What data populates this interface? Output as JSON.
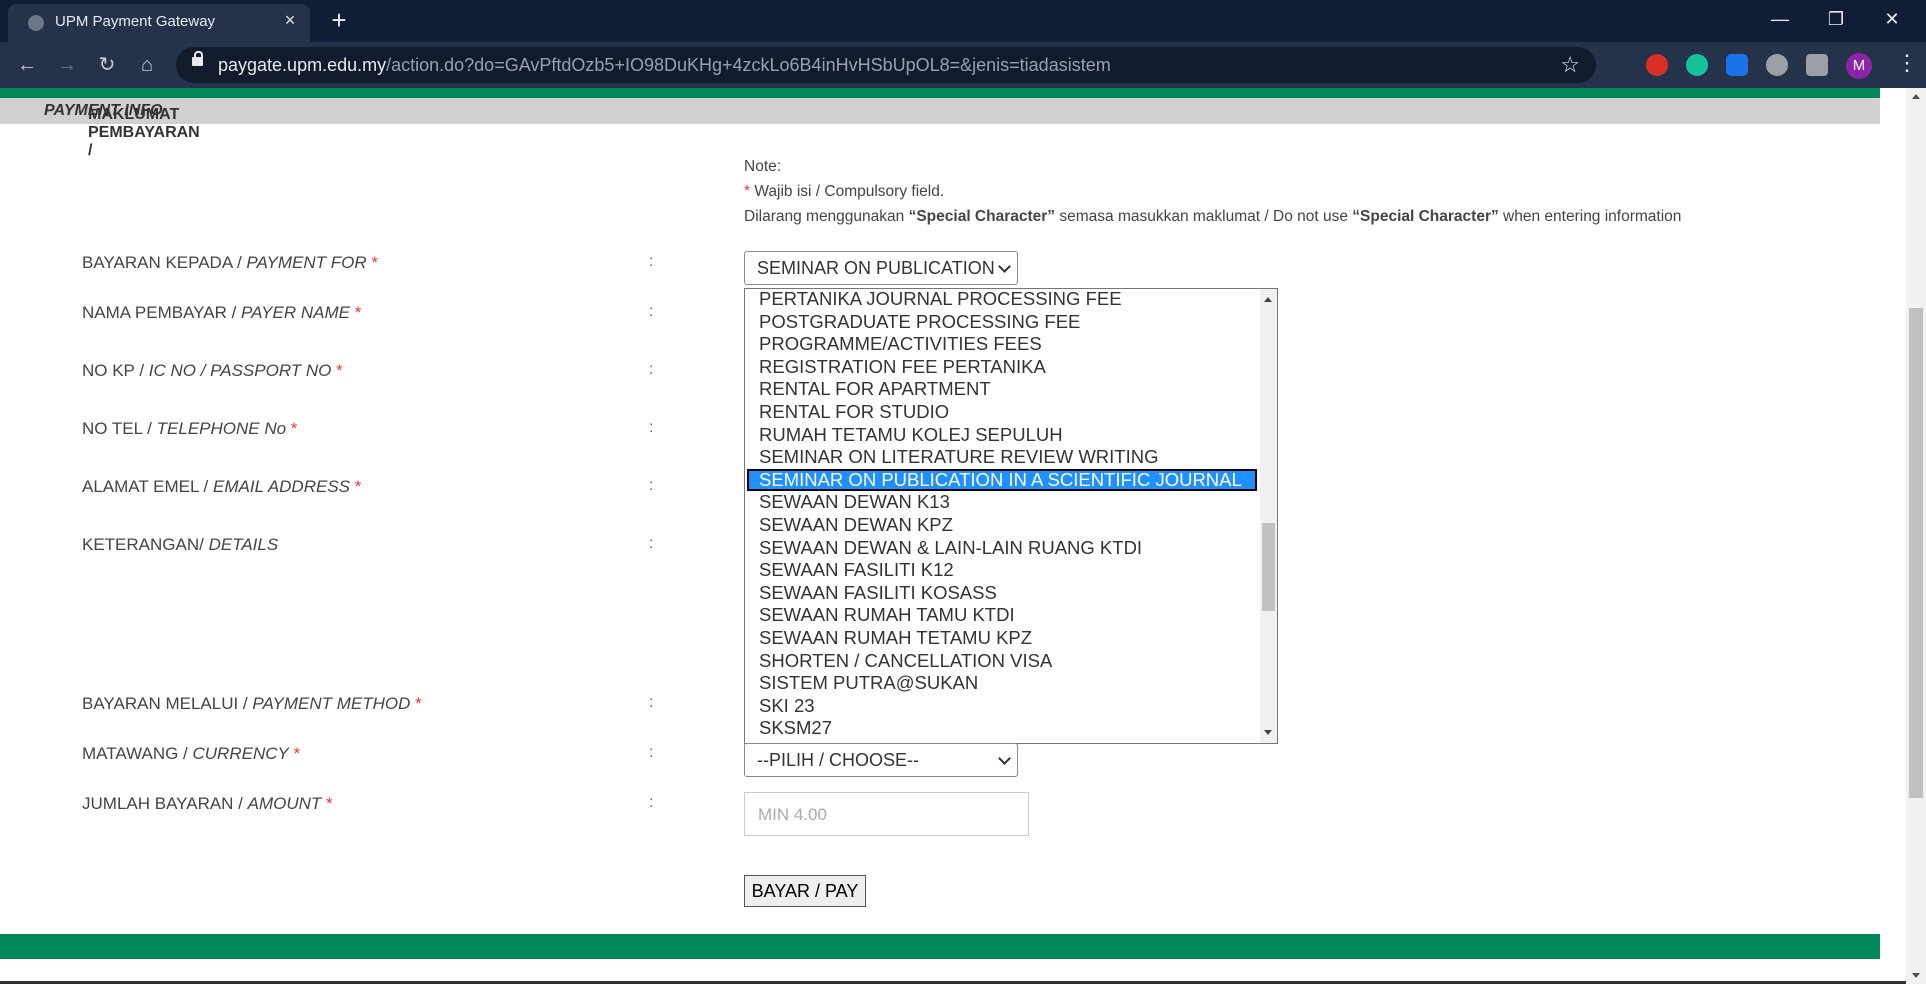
{
  "browser": {
    "tab_title": "UPM Payment Gateway",
    "url_host": "paygate.upm.edu.my",
    "url_rest": "/action.do?do=GAvPftdOzb5+IO98DuKHg+4zckLo6B4inHvHSbUpOL8=&jenis=tiadasistem",
    "profile_initial": "M"
  },
  "header": {
    "title_ms": "MAKLUMAT PEMBAYARAN / ",
    "title_en": "PAYMENT INFO"
  },
  "note": {
    "heading": "Note:",
    "required_mark": "*",
    "required_text": " Wajib isi / Compulsory field.",
    "sc_prefix": "Dilarang menggunakan ",
    "sc_term": "“Special Character”",
    "sc_middle": " semasa masukkan maklumat / Do not use ",
    "sc_term2": "“Special Character”",
    "sc_suffix": " when entering information"
  },
  "form": {
    "colon": ":",
    "required_mark": " *",
    "fields": [
      {
        "ms": "BAYARAN KEPADA / ",
        "en": "PAYMENT FOR"
      },
      {
        "ms": "NAMA PEMBAYAR / ",
        "en": "PAYER NAME"
      },
      {
        "ms": "NO KP / ",
        "en": "IC NO / PASSPORT NO"
      },
      {
        "ms": "NO TEL / ",
        "en": "TELEPHONE No"
      },
      {
        "ms": "ALAMAT EMEL / ",
        "en": "EMAIL ADDRESS"
      },
      {
        "ms": "KETERANGAN/ ",
        "en": "DETAILS"
      },
      {
        "ms": "BAYARAN MELALUI / ",
        "en": "PAYMENT METHOD"
      },
      {
        "ms": "MATAWANG / ",
        "en": "CURRENCY"
      },
      {
        "ms": "JUMLAH BAYARAN / ",
        "en": "AMOUNT"
      }
    ],
    "payment_for_selected": "SEMINAR ON PUBLICATION",
    "currency_selected": "--PILIH / CHOOSE--",
    "amount_placeholder": "MIN 4.00",
    "pay_button": "BAYAR / PAY"
  },
  "dropdown": {
    "options": [
      "PERTANIKA JOURNAL PROCESSING FEE",
      "POSTGRADUATE PROCESSING FEE",
      "PROGRAMME/ACTIVITIES FEES",
      "REGISTRATION FEE PERTANIKA",
      "RENTAL FOR APARTMENT",
      "RENTAL FOR STUDIO",
      "RUMAH TETAMU KOLEJ SEPULUH",
      "SEMINAR ON LITERATURE REVIEW WRITING",
      "SEMINAR ON PUBLICATION IN A SCIENTIFIC JOURNAL",
      "SEWAAN DEWAN K13",
      "SEWAAN DEWAN KPZ",
      "SEWAAN DEWAN & LAIN-LAIN RUANG KTDI",
      "SEWAAN FASILITI K12",
      "SEWAAN FASILITI KOSASS",
      "SEWAAN RUMAH TAMU KTDI",
      "SEWAAN RUMAH TETAMU KPZ",
      "SHORTEN / CANCELLATION VISA",
      "SISTEM PUTRA@SUKAN",
      "SKI 23",
      "SKSM27"
    ],
    "selected": "SEMINAR ON PUBLICATION IN A SCIENTIFIC JOURNAL"
  },
  "colors": {
    "brand_green": "#00875a",
    "selection_blue": "#1e90ff",
    "required_red": "#e53935"
  }
}
